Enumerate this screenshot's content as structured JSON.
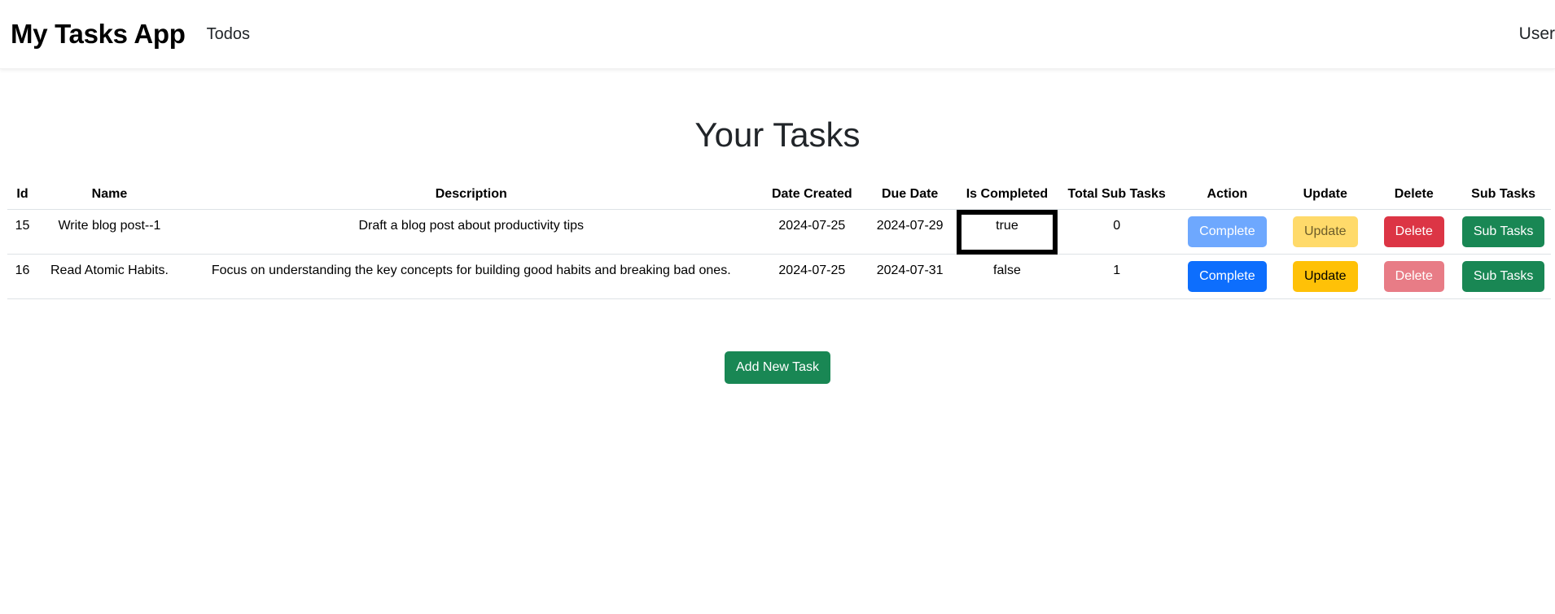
{
  "navbar": {
    "brand": "My Tasks App",
    "link_todos": "Todos",
    "user": "User"
  },
  "main": {
    "title": "Your Tasks",
    "columns": [
      "Id",
      "Name",
      "Description",
      "Date Created",
      "Due Date",
      "Is Completed",
      "Total Sub Tasks",
      "Action",
      "Update",
      "Delete",
      "Sub Tasks"
    ],
    "rows": [
      {
        "id": "15",
        "name": "Write blog post--1",
        "description": "Draft a blog post about productivity tips",
        "date_created": "2024-07-25",
        "due_date": "2024-07-29",
        "is_completed": "true",
        "total_sub_tasks": "0",
        "action_label": "Complete",
        "update_label": "Update",
        "delete_label": "Delete",
        "subtasks_label": "Sub Tasks"
      },
      {
        "id": "16",
        "name": "Read Atomic Habits.",
        "description": "Focus on understanding the key concepts for building good habits and breaking bad ones.",
        "date_created": "2024-07-25",
        "due_date": "2024-07-31",
        "is_completed": "false",
        "total_sub_tasks": "1",
        "action_label": "Complete",
        "update_label": "Update",
        "delete_label": "Delete",
        "subtasks_label": "Sub Tasks"
      }
    ],
    "add_button": "Add New Task"
  },
  "colors": {
    "primary": "#0d6efd",
    "warning": "#ffc107",
    "danger": "#dc3545",
    "success": "#198754"
  }
}
